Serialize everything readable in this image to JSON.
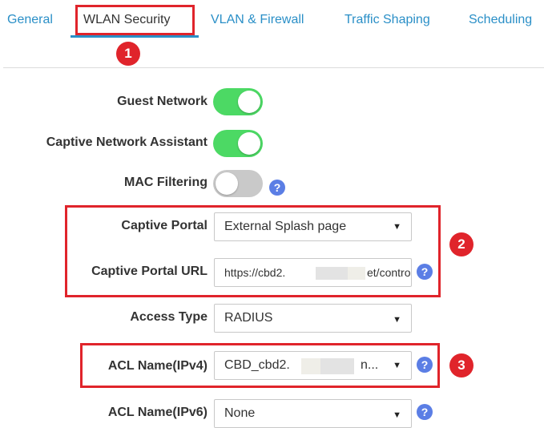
{
  "tabs": [
    {
      "label": "General",
      "active": false
    },
    {
      "label": "WLAN Security",
      "active": true
    },
    {
      "label": "VLAN & Firewall",
      "active": false
    },
    {
      "label": "Traffic Shaping",
      "active": false
    },
    {
      "label": "Scheduling",
      "active": false
    }
  ],
  "annotations": {
    "step1": "1",
    "step2": "2",
    "step3": "3"
  },
  "form": {
    "guest_network": {
      "label": "Guest Network",
      "enabled": true
    },
    "captive_network_assistant": {
      "label": "Captive Network Assistant",
      "enabled": true
    },
    "mac_filtering": {
      "label": "MAC Filtering",
      "enabled": false
    },
    "captive_portal": {
      "label": "Captive Portal",
      "value": "External Splash page"
    },
    "captive_portal_url": {
      "label": "Captive Portal URL",
      "value_prefix": "https://cbd2.",
      "value_suffix": "et/contro"
    },
    "access_type": {
      "label": "Access Type",
      "value": "RADIUS"
    },
    "acl_ipv4": {
      "label": "ACL Name(IPv4)",
      "value_prefix": "CBD_cbd2.",
      "value_suffix": "n..."
    },
    "acl_ipv6": {
      "label": "ACL Name(IPv6)",
      "value": "None"
    }
  },
  "help_glyph": "?",
  "caret_glyph": "▼",
  "colors": {
    "accent": "#2a8fc7",
    "annotation_red": "#e0242b",
    "toggle_on": "#4cd964",
    "toggle_off": "#c9c9c9",
    "help_blue": "#5b7ee5"
  }
}
